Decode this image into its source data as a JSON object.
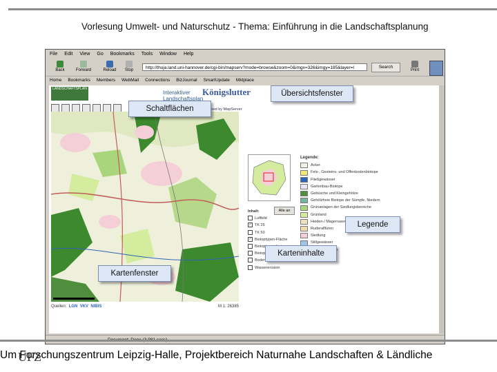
{
  "slide": {
    "title": "Vorlesung Umwelt- und Naturschutz - Thema: Einführung in die Landschaftsplanung",
    "footer": "Um    Forschungszentrum Leipzig-Halle, Projektbereich Naturnahe Landschaften & Ländliche",
    "footer_logo": "UFZ"
  },
  "browser": {
    "menu": [
      "File",
      "Edit",
      "View",
      "Go",
      "Bookmarks",
      "Tools",
      "Window",
      "Help"
    ],
    "nav": {
      "back": "Back",
      "forward": "Forward",
      "reload": "Reload",
      "stop": "Stop",
      "print": "Print",
      "search": "Search"
    },
    "url": "http://thuja.land.uni-hannover.de/cgi-bin/mapserv?mode=browse&zoom=0&imgx=326&imgy=185&layer=l",
    "personal": [
      "Home",
      "Bookmarks",
      "Members",
      "WebMail",
      "Connections",
      "BizJournal",
      "SmartUpdate",
      "Mktplace"
    ],
    "status": "Document: Done (3.981 secs)"
  },
  "page": {
    "logo_left": "LANDSCHAFTSPLAN",
    "header_small": "Interaktiver Landschaftsplan",
    "city": "Königslutter",
    "powered": "Powered by MapServer",
    "legend_title": "Legende:",
    "legend": [
      {
        "label": "Acker",
        "color": "#f4f0e8"
      },
      {
        "label": "Fels-, Gesteins- und Offenbodenbiotope",
        "color": "#f2e87a"
      },
      {
        "label": "Fließgewässer",
        "color": "#2f63b6"
      },
      {
        "label": "Gartenbau-Biotope",
        "color": "#e9e2f4"
      },
      {
        "label": "Gebüsche und Kleingehölze",
        "color": "#4f8e3c"
      },
      {
        "label": "Gehölzfreie Biotope der Sümpfe, Niedern",
        "color": "#78b4a0"
      },
      {
        "label": "Grünanlagen der Siedlungsbereiche",
        "color": "#a9d67c"
      },
      {
        "label": "Grünland",
        "color": "#d3ec9e"
      },
      {
        "label": "Heiden-/ Magerrasen",
        "color": "#efe2c0"
      },
      {
        "label": "Ruderalfluren",
        "color": "#f1d9b0"
      },
      {
        "label": "Siedlung",
        "color": "#f4cfd7"
      },
      {
        "label": "Stillgewässer",
        "color": "#9fc4e8"
      },
      {
        "label": "Verkehrsflächen",
        "color": "#ffffff"
      },
      {
        "label": "Wald",
        "color": "#3d8a2e"
      }
    ],
    "inhalt_title": "Inhalt:",
    "alle_an": "Alle an",
    "layers": [
      {
        "label": "Luftbild",
        "checked": false
      },
      {
        "label": "TK 25",
        "checked": true
      },
      {
        "label": "TK 50",
        "checked": false
      },
      {
        "label": "Biotoptypen-Fläche",
        "checked": true
      },
      {
        "label": "Biotoptypen-Linie",
        "checked": false
      },
      {
        "label": "Biotoptypen-Punkt",
        "checked": false
      },
      {
        "label": "Bodentypen",
        "checked": false
      },
      {
        "label": "Wassererosion",
        "checked": false
      }
    ],
    "quellen": "Quellen:",
    "sources": [
      "LGN",
      "VKV",
      "NIBIS"
    ],
    "coords": "M 1: 26385"
  },
  "callouts": {
    "uebersicht": "Übersichtsfenster",
    "schaltflaechen": "Schaltflächen",
    "legende": "Legende",
    "karteninhalte": "Karteninhalte",
    "kartenfenster": "Kartenfenster"
  }
}
